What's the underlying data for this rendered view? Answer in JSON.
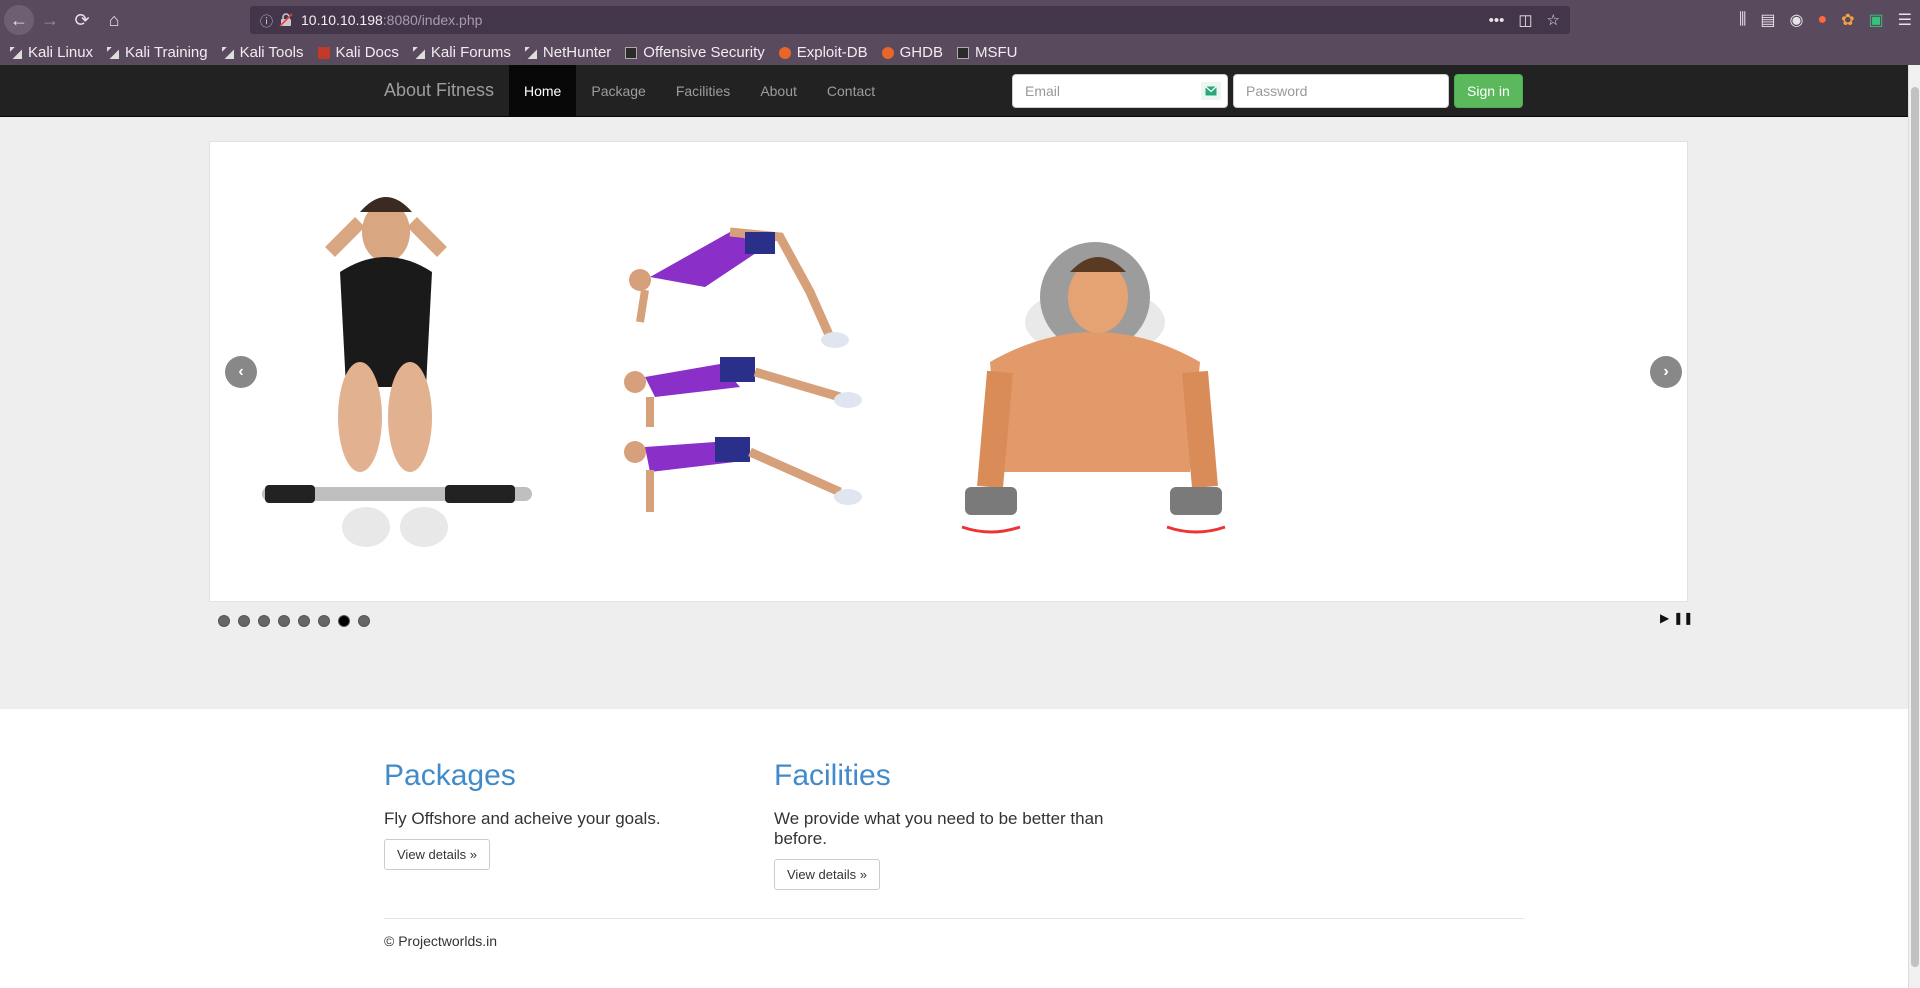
{
  "browser": {
    "url_host": "10.10.10.198",
    "url_path": ":8080/index.php",
    "bookmarks": [
      "Kali Linux",
      "Kali Training",
      "Kali Tools",
      "Kali Docs",
      "Kali Forums",
      "NetHunter",
      "Offensive Security",
      "Exploit-DB",
      "GHDB",
      "MSFU"
    ]
  },
  "navbar": {
    "brand": "About Fitness",
    "links": [
      "Home",
      "Package",
      "Facilities",
      "About",
      "Contact"
    ],
    "email_placeholder": "Email",
    "password_placeholder": "Password",
    "signin_label": "Sign in"
  },
  "slider": {
    "dots": 8,
    "active_dot": 7,
    "prev_glyph": "‹",
    "next_glyph": "›"
  },
  "sections": {
    "packages": {
      "title": "Packages",
      "text": "Fly Offshore and acheive your goals.",
      "button": "View details »"
    },
    "facilities": {
      "title": "Facilities",
      "text": "We provide what you need to be better than before.",
      "button": "View details »"
    }
  },
  "footer": {
    "text": "© Projectworlds.in"
  }
}
